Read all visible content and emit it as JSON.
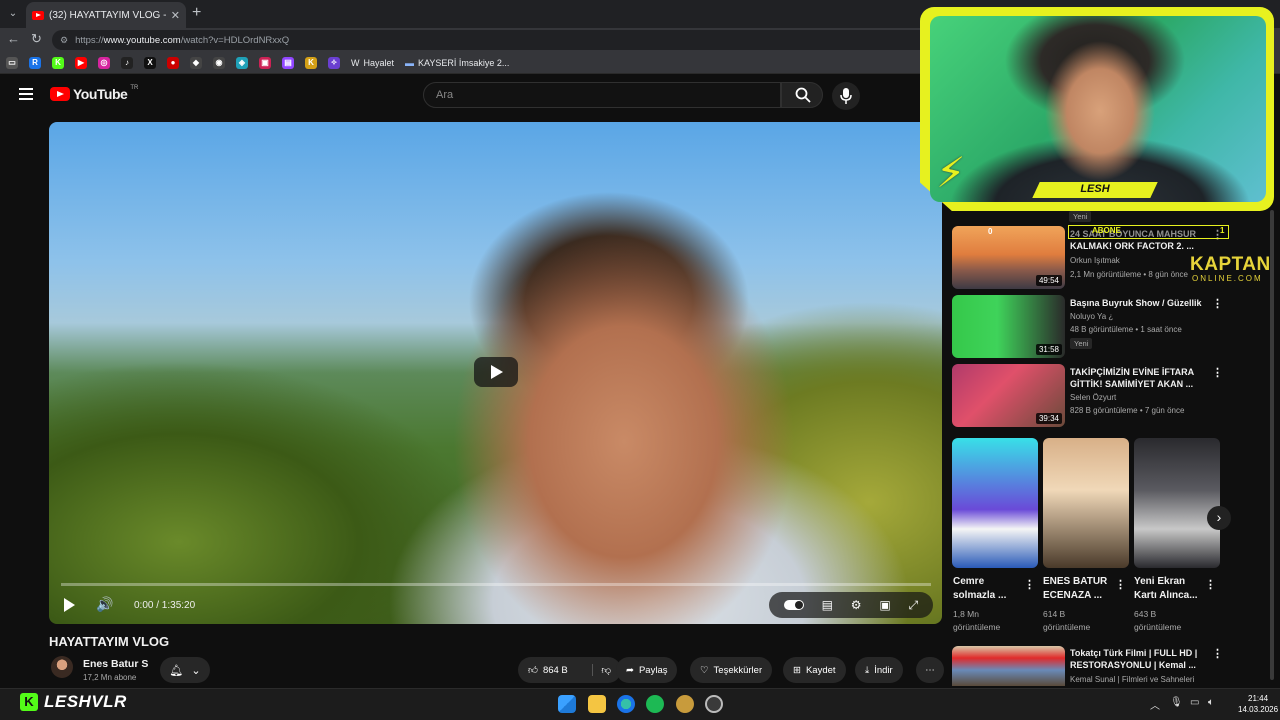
{
  "browser": {
    "tab_title": "(32) HAYATTAYIM VLOG - YouTube",
    "tab_close": "✕",
    "new_tab": "+",
    "url_prefix": "https://",
    "url_host": "www.youtube.com",
    "url_path": "/watch?v=HDLOrdNRxxQ",
    "bookmarks": [
      {
        "letter": "R",
        "color": "#1a73e8"
      },
      {
        "letter": "K",
        "color": "#53fc18"
      },
      {
        "letter": "▶",
        "color": "#ff0000"
      },
      {
        "letter": "◎",
        "color": "#d6249f"
      },
      {
        "letter": "♪",
        "color": "#222222"
      },
      {
        "letter": "X",
        "color": "#111111"
      },
      {
        "letter": "●",
        "color": "#cc0000"
      },
      {
        "letter": "◆",
        "color": "#444444"
      },
      {
        "letter": "◉",
        "color": "#444444"
      },
      {
        "letter": "◈",
        "color": "#1fa1b8"
      },
      {
        "letter": "▣",
        "color": "#cc2255"
      },
      {
        "letter": "▤",
        "color": "#9146ff"
      },
      {
        "letter": "K",
        "color": "#d4a017"
      },
      {
        "letter": "✧",
        "color": "#6a3fd1"
      }
    ],
    "bookmark_named": [
      {
        "label": "Hayalet",
        "icon": "W"
      },
      {
        "label": "KAYSERİ İmsakiye 2...",
        "icon": "▬"
      }
    ]
  },
  "youtube": {
    "logo_text": "YouTube",
    "logo_sup": "TR",
    "search_placeholder": "Ara"
  },
  "video": {
    "title": "HAYATTAYIM VLOG",
    "time": "0:00 / 1:35:20",
    "progress": 0.0,
    "channel": "Enes Batur S",
    "subscribers": "17,2 Mn abone",
    "likes": "864 B",
    "share": "Paylaş",
    "thanks": "Teşekkürler",
    "save": "Kaydet",
    "download": "İndir"
  },
  "sidebar": {
    "top_partial_badge": "Yeni",
    "videos": [
      {
        "title": "24 SAAT BOYUNCA MAHSUR KALMAK! ORK FACTOR 2. ...",
        "channel": "Orkun Işıtmak",
        "meta": "2,1 Mn görüntüleme • 8 gün önce",
        "duration": "49:54",
        "badge": ""
      },
      {
        "title": "Başına Buyruk Show / Güzellik",
        "channel": "Noluyo Ya ¿",
        "meta": "48 B görüntüleme • 1 saat önce",
        "duration": "31:58",
        "badge": "Yeni"
      },
      {
        "title": "TAKİPÇİMİZİN EVİNE İFTARA GİTTİK! SAMİMİYET AKAN ...",
        "channel": "Selen Özyurt",
        "meta": "828 B görüntüleme • 7 gün önce",
        "duration": "39:34",
        "badge": ""
      }
    ],
    "shorts": [
      {
        "title": "Cemre solmazla ...",
        "views_line1": "1,8 Mn",
        "views_line2": "görüntüleme"
      },
      {
        "title": "ENES BATUR ECENAZA ...",
        "views_line1": "614 B",
        "views_line2": "görüntüleme"
      },
      {
        "title": "Yeni Ekran Kartı Alınca...",
        "views_line1": "643 B",
        "views_line2": "görüntüleme"
      }
    ],
    "last_video": {
      "title": "Tokatçı Türk Filmi | FULL HD | RESTORASYONLU | Kemal ...",
      "channel": "Kemal Sunal | Filmleri ve Sahneleri"
    }
  },
  "overlay": {
    "cam_name": "LESH",
    "abone_label": "ABONE",
    "abone_count": "1",
    "thumb_counter": "0",
    "sponsor_line1": "KAPTAN",
    "sponsor_line2": "ONLINE.COM",
    "stream_brand": "LESHVLR"
  },
  "taskbar": {
    "time": "21:44",
    "date": "14.03.2026"
  },
  "colors": {
    "accent_red": "#ff0000",
    "overlay_yellow": "#e7f11f",
    "kick_green": "#53fc18"
  }
}
